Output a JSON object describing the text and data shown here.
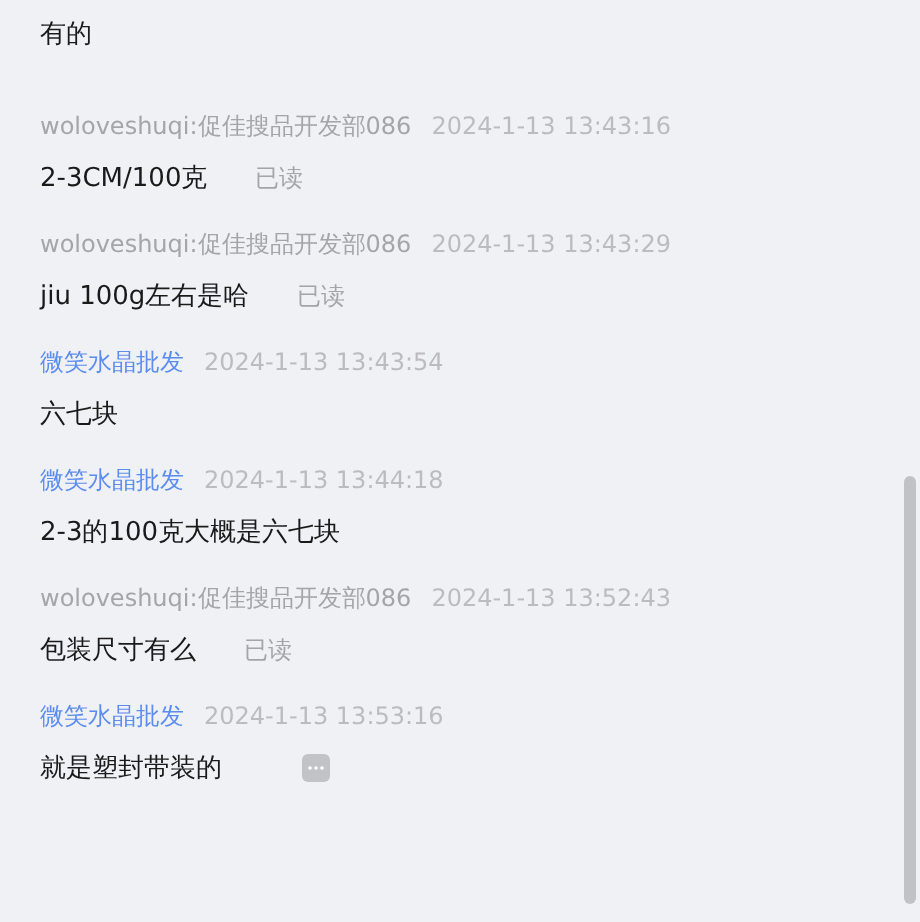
{
  "messages": [
    {
      "text": "有的",
      "read": false,
      "show_more": false
    },
    {
      "sender": "woloveshuqi:促佳搜品开发部086",
      "color": "#a5a5a8",
      "time": "2024-1-13 13:43:16",
      "text": "2-3CM/100克",
      "read": true,
      "read_label": "已读",
      "show_more": false
    },
    {
      "sender": "woloveshuqi:促佳搜品开发部086",
      "color": "#a5a5a8",
      "time": "2024-1-13 13:43:29",
      "text": "jiu 100g左右是哈",
      "read": true,
      "read_label": "已读",
      "show_more": false
    },
    {
      "sender": "微笑水晶批发",
      "color": "#5b8cf0",
      "time": "2024-1-13 13:43:54",
      "text": "六七块",
      "read": false,
      "show_more": false
    },
    {
      "sender": "微笑水晶批发",
      "color": "#5b8cf0",
      "time": "2024-1-13 13:44:18",
      "text": "2-3的100克大概是六七块",
      "read": false,
      "show_more": false
    },
    {
      "sender": "woloveshuqi:促佳搜品开发部086",
      "color": "#a5a5a8",
      "time": "2024-1-13 13:52:43",
      "text": "包装尺寸有么",
      "read": true,
      "read_label": "已读",
      "show_more": false
    },
    {
      "sender": "微笑水晶批发",
      "color": "#5b8cf0",
      "time": "2024-1-13 13:53:16",
      "text": "就是塑封带装的",
      "read": false,
      "show_more": true
    }
  ]
}
